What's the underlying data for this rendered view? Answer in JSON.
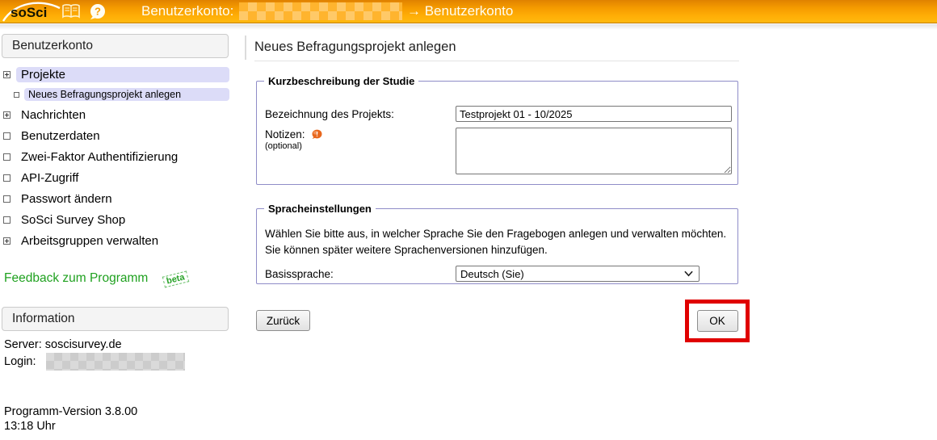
{
  "header": {
    "logo_text": "soSci",
    "breadcrumb_label": "Benutzerkonto:",
    "breadcrumb_target": "→ Benutzerkonto",
    "icons": {
      "manual": "book-icon",
      "help": "speech-question-icon",
      "help_glyph": "?"
    }
  },
  "sidebar": {
    "section_title": "Benutzerkonto",
    "items": [
      {
        "id": "projekte",
        "label": "Projekte",
        "expand": "plus",
        "highlighted": true,
        "sub": false
      },
      {
        "id": "neues-befragungsprojekt-anlegen",
        "label": "Neues Befragungsprojekt anlegen",
        "expand": "box",
        "highlighted": true,
        "sub": true
      },
      {
        "id": "nachrichten",
        "label": "Nachrichten",
        "expand": "plus",
        "highlighted": false,
        "sub": false
      },
      {
        "id": "benutzerdaten",
        "label": "Benutzerdaten",
        "expand": "box",
        "highlighted": false,
        "sub": false
      },
      {
        "id": "zwei-faktor-authentifizierung",
        "label": "Zwei-Faktor Authentifizierung",
        "expand": "box",
        "highlighted": false,
        "sub": false
      },
      {
        "id": "api-zugriff",
        "label": "API-Zugriff",
        "expand": "box",
        "highlighted": false,
        "sub": false
      },
      {
        "id": "passwort-aendern",
        "label": "Passwort ändern",
        "expand": "box",
        "highlighted": false,
        "sub": false
      },
      {
        "id": "sosci-survey-shop",
        "label": "SoSci Survey Shop",
        "expand": "box",
        "highlighted": false,
        "sub": false
      },
      {
        "id": "arbeitsgruppen-verwalten",
        "label": "Arbeitsgruppen verwalten",
        "expand": "plus",
        "highlighted": false,
        "sub": false
      }
    ],
    "feedback_link": "Feedback zum Programm",
    "feedback_badge": "beta",
    "info_title": "Information",
    "server_label": "Server: soscisurvey.de",
    "login_label": "Login:",
    "version": "Programm-Version 3.8.00",
    "time": "13:18 Uhr"
  },
  "main": {
    "title": "Neues Befragungsprojekt anlegen",
    "study_fieldset": {
      "legend": "Kurzbeschreibung der Studie",
      "project_name_label": "Bezeichnung des Projekts:",
      "project_name_value": "Testprojekt 01 - 10/2025",
      "notes_label": "Notizen:",
      "notes_help_glyph": "!",
      "notes_optional": "(optional)",
      "notes_value": ""
    },
    "language_fieldset": {
      "legend": "Spracheinstellungen",
      "description": "Wählen Sie bitte aus, in welcher Sprache Sie den Fragebogen anlegen und verwalten möchten. Sie können später weitere Sprachenversionen hinzufügen.",
      "base_language_label": "Basissprache:",
      "base_language_value": "Deutsch (Sie)"
    },
    "back_button": "Zurück",
    "ok_button": "OK"
  },
  "colors": {
    "header_orange": "#f59b00",
    "sidebar_highlight": "#dcdcf8",
    "fieldset_border": "#8f8cc8",
    "feedback_green": "#1fa11f",
    "annotation_red": "#e00000"
  }
}
